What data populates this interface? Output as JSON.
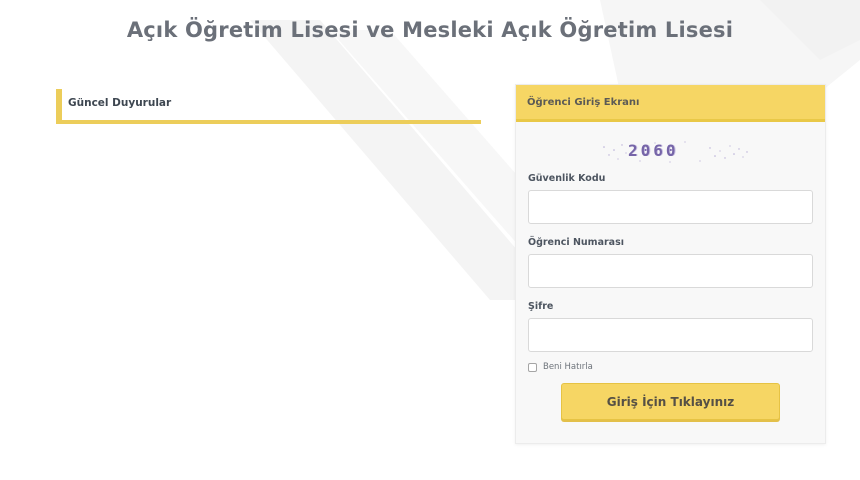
{
  "page": {
    "title": "Açık Öğretim Lisesi ve Mesleki Açık Öğretim Lisesi"
  },
  "announcements": {
    "title": "Güncel Duyurular"
  },
  "login": {
    "header": "Öğrenci Giriş Ekranı",
    "captcha_code": "2060",
    "security_code_label": "Güvenlik Kodu",
    "security_code_value": "",
    "student_number_label": "Öğrenci Numarası",
    "student_number_value": "",
    "password_label": "Şifre",
    "password_value": "",
    "remember_label": "Beni Hatırla",
    "remember_checked": false,
    "submit_label": "Giriş İçin Tıklayınız"
  },
  "colors": {
    "accent": "#f6d664",
    "accent_border": "#eccd5a",
    "title_text": "#6b7079",
    "captcha_text": "#7665a8"
  }
}
